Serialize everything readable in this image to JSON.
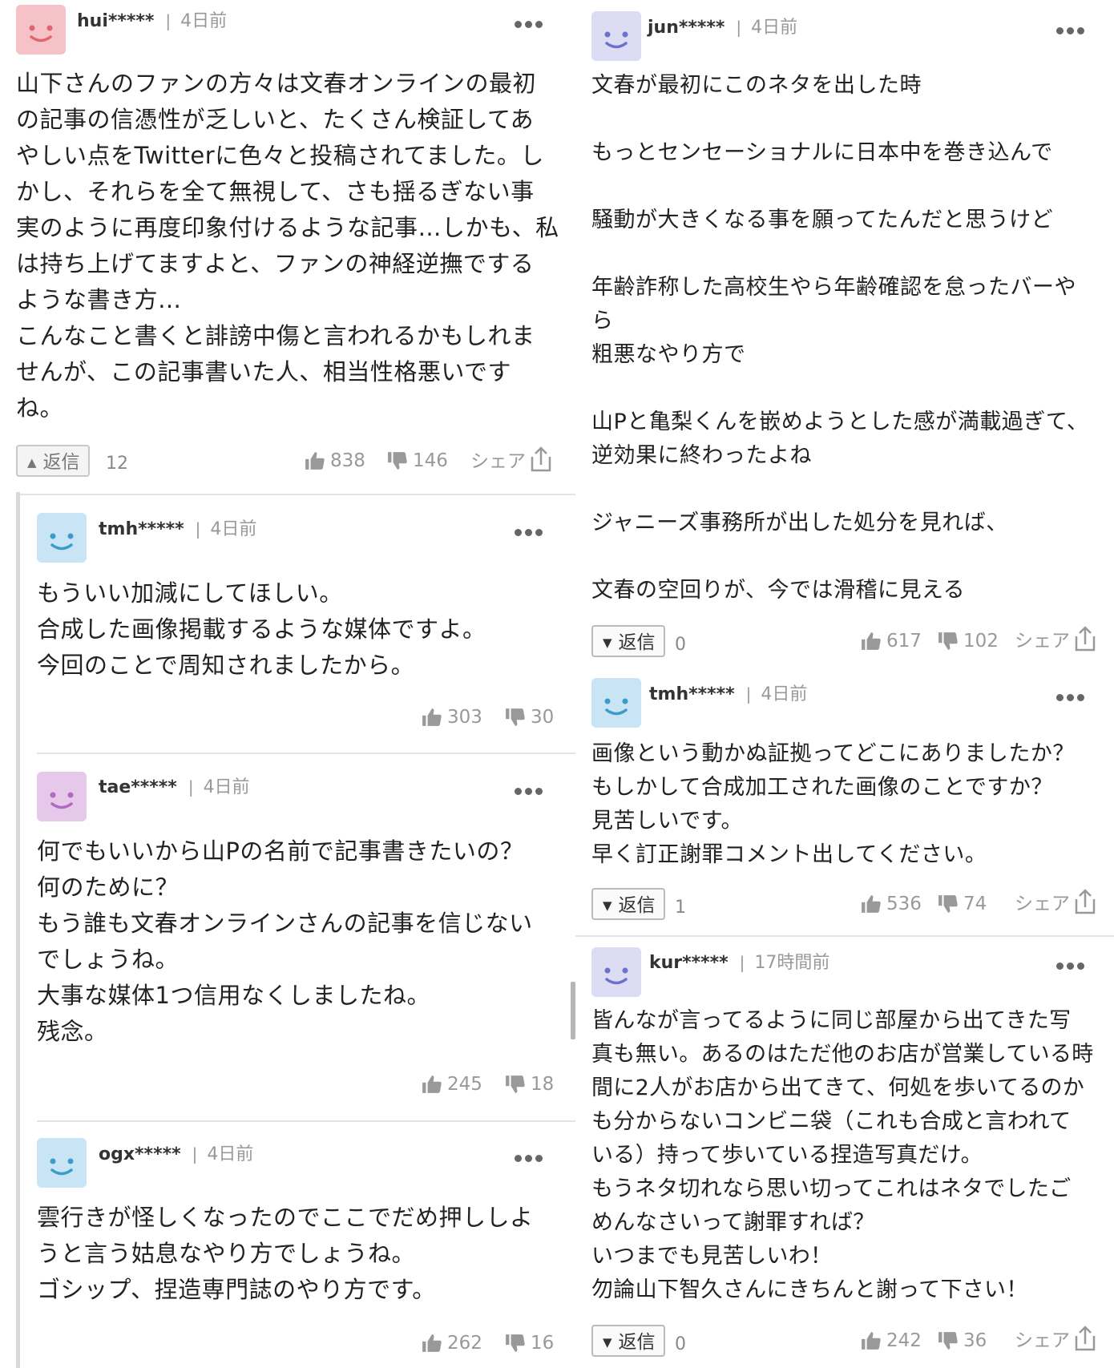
{
  "colors": {
    "avatar_pink": "#f5c2c7",
    "avatar_blue": "#c9e5f5",
    "avatar_purple": "#e5c8ea",
    "avatar_lavender": "#dcdcf5"
  },
  "comments": {
    "c1": {
      "user": "hui*****",
      "sep": "|",
      "time": "4日前",
      "body": "山下さんのファンの方々は文春オンラインの最初\nの記事の信憑性が乏しいと、たくさん検証してあ\nやしい点をTwitterに色々と投稿されてました。し\nかし、それらを全て無視して、さも揺るぎない事\n実のように再度印象付けるような記事…しかも、私\nは持ち上げてますよと、ファンの神経逆撫でする\nような書き方…\nこんなこと書くと誹謗中傷と言われるかもしれま\nせんが、この記事書いた人、相当性格悪いです\nね。",
      "reply_label": "返信",
      "reply_count": "12",
      "likes": "838",
      "dislikes": "146",
      "share": "シェア",
      "avatar_icon": "smiley-icon"
    },
    "c2": {
      "user": "tmh*****",
      "sep": "|",
      "time": "4日前",
      "body": "もういい加減にしてほしい。\n合成した画像掲載するような媒体ですよ。\n今回のことで周知されましたから。",
      "likes": "303",
      "dislikes": "30"
    },
    "c3": {
      "user": "tae*****",
      "sep": "|",
      "time": "4日前",
      "body": "何でもいいから山Pの名前で記事書きたいの？\n何のために？\nもう誰も文春オンラインさんの記事を信じない\nでしょうね。\n大事な媒体1つ信用なくしましたね。\n残念。",
      "likes": "245",
      "dislikes": "18"
    },
    "c4": {
      "user": "ogx*****",
      "sep": "|",
      "time": "4日前",
      "body": "雲行きが怪しくなったのでここでだめ押ししよ\nうと言う姑息なやり方でしょうね。\nゴシップ、捏造専門誌のやり方です。",
      "likes": "262",
      "dislikes": "16"
    },
    "c5": {
      "user": "jun*****",
      "sep": "|",
      "time": "4日前",
      "body": "文春が最初にこのネタを出した時\n\nもっとセンセーショナルに日本中を巻き込んで\n\n騒動が大きくなる事を願ってたんだと思うけど\n\n年齢詐称した高校生やら年齢確認を怠ったバーや\nら\n粗悪なやり方で\n\n山Pと亀梨くんを嵌めようとした感が満載過ぎて、\n逆効果に終わったよね\n\nジャニーズ事務所が出した処分を見れば、\n\n文春の空回りが、今では滑稽に見える",
      "reply_label": "返信",
      "reply_count": "0",
      "likes": "617",
      "dislikes": "102",
      "share": "シェア"
    },
    "c6": {
      "user": "tmh*****",
      "sep": "|",
      "time": "4日前",
      "body": "画像という動かぬ証拠ってどこにありましたか？\nもしかして合成加工された画像のことですか？\n見苦しいです。\n早く訂正謝罪コメント出してください。",
      "reply_label": "返信",
      "reply_count": "1",
      "likes": "536",
      "dislikes": "74",
      "share": "シェア"
    },
    "c7": {
      "user": "kur*****",
      "sep": "|",
      "time": "17時間前",
      "body": "皆んなが言ってるように同じ部屋から出てきた写\n真も無い。あるのはただ他のお店が営業している時\n間に2人がお店から出てきて、何処を歩いてるのか\nも分からないコンビニ袋（これも合成と言われて\nいる）持って歩いている捏造写真だけ。\nもうネタ切れなら思い切ってこれはネタでしたご\nめんなさいって謝罪すれば？\nいつまでも見苦しいわ！\n勿論山下智久さんにきちんと謝って下さい！",
      "reply_label": "返信",
      "reply_count": "0",
      "likes": "242",
      "dislikes": "36",
      "share": "シェア"
    }
  }
}
